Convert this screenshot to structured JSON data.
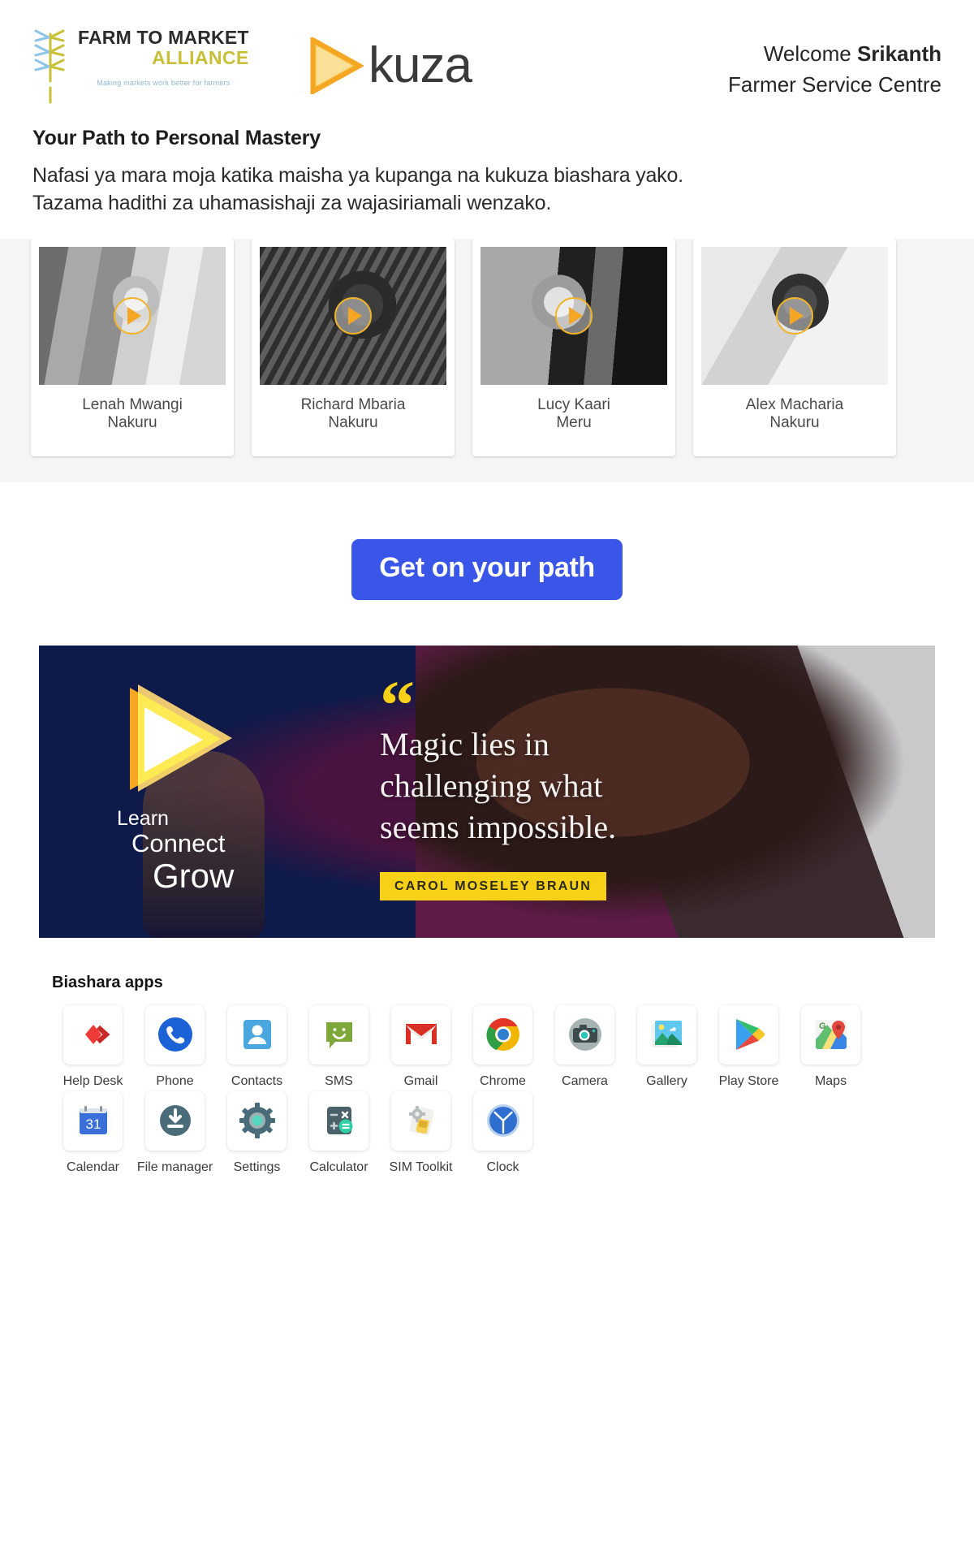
{
  "header": {
    "fma_logo": {
      "line1": "FARM TO MARKET",
      "line2": "ALLIANCE",
      "tagline": "Making markets work better for farmers",
      "icon": "wheat-stalk-icon"
    },
    "kuza_logo": {
      "wordmark": "kuza",
      "icon": "kuza-play-triangle-icon"
    },
    "welcome_prefix": "Welcome ",
    "welcome_name": "Srikanth",
    "role": "Farmer Service Centre"
  },
  "intro": {
    "title": "Your Path to Personal Mastery",
    "line1": "Nafasi ya mara moja katika maisha ya kupanga na kukuza biashara yako.",
    "line2": "Tazama hadithi za uhamasishaji za wajasiriamali wenzako."
  },
  "carousel": {
    "cards": [
      {
        "name": "Lenah Mwangi",
        "location": "Nakuru",
        "play_icon": "play-icon"
      },
      {
        "name": "Richard Mbaria",
        "location": "Nakuru",
        "play_icon": "play-icon"
      },
      {
        "name": "Lucy Kaari",
        "location": "Meru",
        "play_icon": "play-icon"
      },
      {
        "name": "Alex Macharia",
        "location": "Nakuru",
        "play_icon": "play-icon"
      }
    ]
  },
  "cta": {
    "label": "Get on your path",
    "color": "#3a56e8"
  },
  "banner": {
    "learn": "Learn",
    "connect": "Connect",
    "grow": "Grow",
    "quote_mark": "“",
    "quote_line1": "Magic lies in",
    "quote_line2": "challenging what",
    "quote_line3": "seems impossible.",
    "author": "CAROL MOSELEY BRAUN",
    "accent_color": "#f7d117"
  },
  "apps": {
    "title": "Biashara apps",
    "items": [
      {
        "label": "Help Desk",
        "icon": "anydesk-icon"
      },
      {
        "label": "Phone",
        "icon": "phone-icon"
      },
      {
        "label": "Contacts",
        "icon": "contacts-icon"
      },
      {
        "label": "SMS",
        "icon": "sms-icon"
      },
      {
        "label": "Gmail",
        "icon": "gmail-icon"
      },
      {
        "label": "Chrome",
        "icon": "chrome-icon"
      },
      {
        "label": "Camera",
        "icon": "camera-icon"
      },
      {
        "label": "Gallery",
        "icon": "gallery-icon"
      },
      {
        "label": "Play Store",
        "icon": "play-store-icon"
      },
      {
        "label": "Maps",
        "icon": "maps-icon"
      },
      {
        "label": "Calendar",
        "icon": "calendar-icon"
      },
      {
        "label": "File manager",
        "icon": "file-manager-icon"
      },
      {
        "label": "Settings",
        "icon": "gear-icon"
      },
      {
        "label": "Calculator",
        "icon": "calculator-icon"
      },
      {
        "label": "SIM Toolkit",
        "icon": "sim-toolkit-icon"
      },
      {
        "label": "Clock",
        "icon": "clock-icon"
      }
    ]
  }
}
